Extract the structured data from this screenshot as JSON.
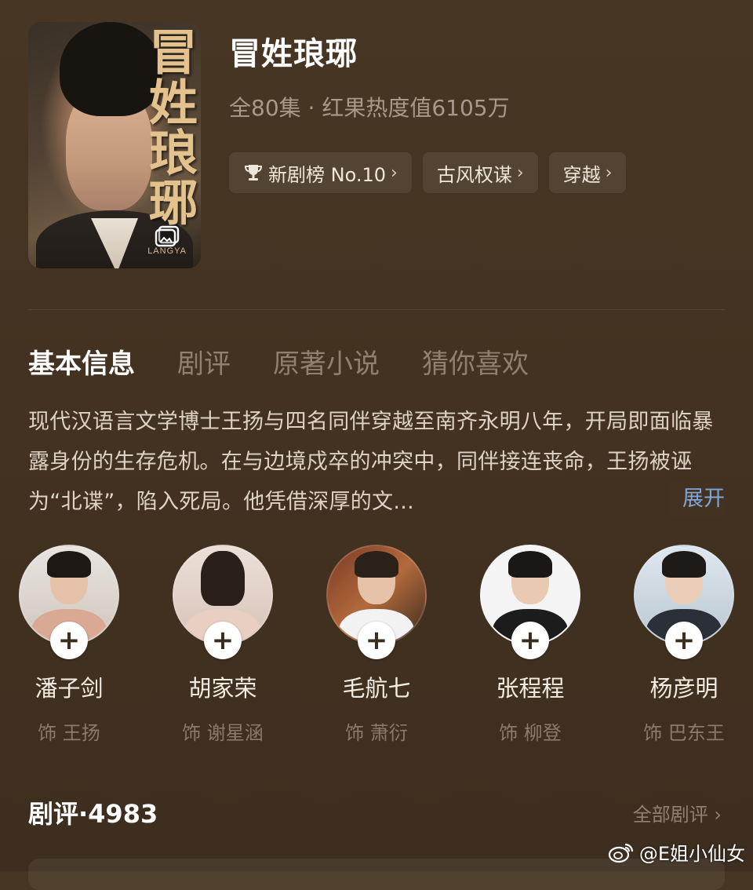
{
  "drama": {
    "title": "冒姓琅琊",
    "meta": "全80集 · 红果热度值6105万",
    "poster": {
      "title_art": "冒姓琅琊",
      "subtitle_art": "LANGYA"
    },
    "tags": [
      {
        "label": "新剧榜 No.10",
        "icon": "trophy-icon"
      },
      {
        "label": "古风权谋"
      },
      {
        "label": "穿越"
      }
    ]
  },
  "tabs": [
    "基本信息",
    "剧评",
    "原著小说",
    "猜你喜欢"
  ],
  "synopsis": {
    "text": "现代汉语言文学博士王扬与四名同伴穿越至南齐永明八年，开局即面临暴露身份的生存危机。在与边境戍卒的冲突中，同伴接连丧命，王扬被诬为“北谍”，陷入死局。他凭借深厚的文...",
    "expand_label": "展开"
  },
  "cast": [
    {
      "name": "潘子剑",
      "role": "饰 王扬"
    },
    {
      "name": "胡家荣",
      "role": "饰 谢星涵"
    },
    {
      "name": "毛航七",
      "role": "饰 萧衍"
    },
    {
      "name": "张程程",
      "role": "饰 柳登"
    },
    {
      "name": "杨彦明",
      "role": "饰 巴东王"
    }
  ],
  "reviews": {
    "heading": "剧评·4983",
    "all_label": "全部剧评"
  },
  "watermark": "@E姐小仙女",
  "colors": {
    "background": "#453422",
    "link": "#7ea6d8",
    "poster_title": "#e3c28d"
  }
}
